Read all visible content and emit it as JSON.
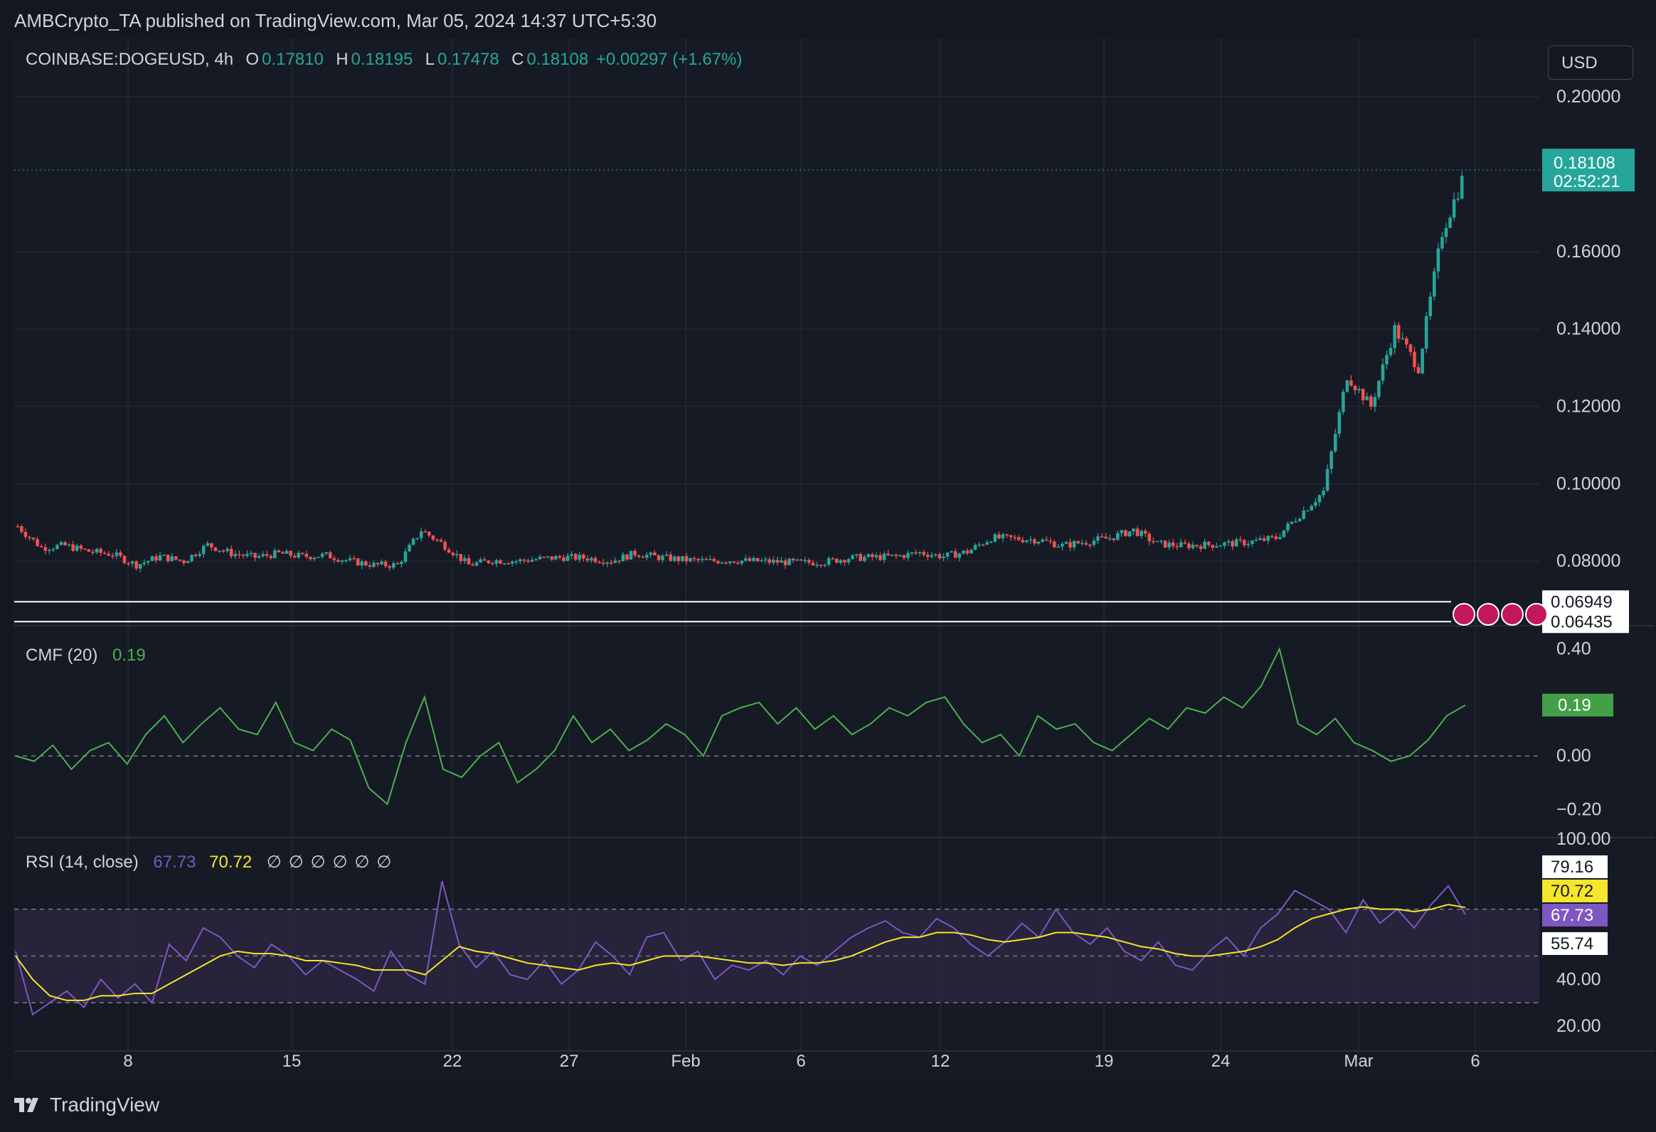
{
  "header": {
    "published_text": "AMBCrypto_TA published on TradingView.com, Mar 05, 2024 14:37 UTC+5:30"
  },
  "currency_button": "USD",
  "footer": {
    "brand": "TradingView"
  },
  "colors": {
    "background": "#131722",
    "panel": "#161a25",
    "grid": "#242833",
    "up": "#26a69a",
    "down": "#ef5350",
    "cmf_line": "#4caf50",
    "rsi_line": "#7e57c2",
    "rsi_ma": "#f5e52b",
    "rsi_band": "#2a2540"
  },
  "chart_data": [
    {
      "type": "candlestick",
      "title": "COINBASE:DOGEUSD, 4h",
      "symbol": "COINBASE:DOGEUSD",
      "interval": "4h",
      "ohlc_labels": {
        "O": "0.17810",
        "H": "0.18195",
        "L": "0.17478",
        "C": "0.18108"
      },
      "change": "+0.00297 (+1.67%)",
      "last_price": "0.18108",
      "countdown": "02:52:21",
      "price_axis_ticks": [
        "0.20000",
        "0.16000",
        "0.14000",
        "0.12000",
        "0.10000",
        "0.08000"
      ],
      "horizontal_lines": [
        {
          "value": 0.06949,
          "label": "0.06949"
        },
        {
          "value": 0.06435,
          "label": "0.06435"
        }
      ],
      "ylim": [
        0.0655,
        0.2085
      ],
      "x_axis_ticks": [
        "8",
        "15",
        "22",
        "27",
        "Feb",
        "6",
        "12",
        "19",
        "24",
        "Mar",
        "6"
      ],
      "close_series": [
        {
          "d": "Jan 4",
          "v": 0.089
        },
        {
          "d": "Jan 5",
          "v": 0.0835
        },
        {
          "d": "Jan 6",
          "v": 0.084
        },
        {
          "d": "Jan 7",
          "v": 0.0825
        },
        {
          "d": "Jan 8",
          "v": 0.0818
        },
        {
          "d": "Jan 9",
          "v": 0.079
        },
        {
          "d": "Jan 10",
          "v": 0.0812
        },
        {
          "d": "Jan 11",
          "v": 0.08
        },
        {
          "d": "Jan 12",
          "v": 0.0842
        },
        {
          "d": "Jan 13",
          "v": 0.082
        },
        {
          "d": "Jan 14",
          "v": 0.081
        },
        {
          "d": "Jan 15",
          "v": 0.082
        },
        {
          "d": "Jan 16",
          "v": 0.0812
        },
        {
          "d": "Jan 17",
          "v": 0.0815
        },
        {
          "d": "Jan 18",
          "v": 0.08
        },
        {
          "d": "Jan 19",
          "v": 0.079
        },
        {
          "d": "Jan 20",
          "v": 0.079
        },
        {
          "d": "Jan 21",
          "v": 0.088
        },
        {
          "d": "Jan 22",
          "v": 0.084
        },
        {
          "d": "Jan 23",
          "v": 0.079
        },
        {
          "d": "Jan 24",
          "v": 0.0802
        },
        {
          "d": "Jan 25",
          "v": 0.08
        },
        {
          "d": "Jan 26",
          "v": 0.0806
        },
        {
          "d": "Jan 27",
          "v": 0.081
        },
        {
          "d": "Jan 28",
          "v": 0.0808
        },
        {
          "d": "Jan 29",
          "v": 0.08
        },
        {
          "d": "Jan 30",
          "v": 0.082
        },
        {
          "d": "Jan 31",
          "v": 0.081
        },
        {
          "d": "Feb 1",
          "v": 0.0804
        },
        {
          "d": "Feb 2",
          "v": 0.08
        },
        {
          "d": "Feb 3",
          "v": 0.0802
        },
        {
          "d": "Feb 4",
          "v": 0.08
        },
        {
          "d": "Feb 5",
          "v": 0.0798
        },
        {
          "d": "Feb 6",
          "v": 0.0796
        },
        {
          "d": "Feb 7",
          "v": 0.0798
        },
        {
          "d": "Feb 8",
          "v": 0.0808
        },
        {
          "d": "Feb 9",
          "v": 0.081
        },
        {
          "d": "Feb 10",
          "v": 0.0812
        },
        {
          "d": "Feb 11",
          "v": 0.0822
        },
        {
          "d": "Feb 12",
          "v": 0.0812
        },
        {
          "d": "Feb 13",
          "v": 0.0824
        },
        {
          "d": "Feb 14",
          "v": 0.086
        },
        {
          "d": "Feb 15",
          "v": 0.0858
        },
        {
          "d": "Feb 16",
          "v": 0.0855
        },
        {
          "d": "Feb 17",
          "v": 0.084
        },
        {
          "d": "Feb 18",
          "v": 0.085
        },
        {
          "d": "Feb 19",
          "v": 0.086
        },
        {
          "d": "Feb 20",
          "v": 0.088
        },
        {
          "d": "Feb 21",
          "v": 0.0845
        },
        {
          "d": "Feb 22",
          "v": 0.084
        },
        {
          "d": "Feb 23",
          "v": 0.0842
        },
        {
          "d": "Feb 24",
          "v": 0.0845
        },
        {
          "d": "Feb 25",
          "v": 0.085
        },
        {
          "d": "Feb 26",
          "v": 0.086
        },
        {
          "d": "Feb 27",
          "v": 0.092
        },
        {
          "d": "Feb 28",
          "v": 0.098
        },
        {
          "d": "Feb 29",
          "v": 0.128
        },
        {
          "d": "Mar 1",
          "v": 0.12
        },
        {
          "d": "Mar 2",
          "v": 0.14
        },
        {
          "d": "Mar 3",
          "v": 0.13
        },
        {
          "d": "Mar 4",
          "v": 0.165
        },
        {
          "d": "Mar 5",
          "v": 0.1811
        }
      ]
    },
    {
      "type": "line",
      "title": "CMF (20)",
      "last_value": "0.19",
      "y_axis_ticks": [
        "0.40",
        "0.00",
        "−0.20"
      ],
      "ylim": [
        -0.3,
        0.46
      ],
      "series": [
        {
          "values": [
            0.0,
            -0.02,
            0.04,
            -0.05,
            0.02,
            0.05,
            -0.03,
            0.08,
            0.15,
            0.05,
            0.12,
            0.18,
            0.1,
            0.08,
            0.2,
            0.05,
            0.02,
            0.1,
            0.06,
            -0.12,
            -0.18,
            0.05,
            0.22,
            -0.05,
            -0.08,
            0.0,
            0.05,
            -0.1,
            -0.05,
            0.02,
            0.15,
            0.05,
            0.1,
            0.02,
            0.06,
            0.12,
            0.08,
            0.0,
            0.15,
            0.18,
            0.2,
            0.12,
            0.18,
            0.1,
            0.15,
            0.08,
            0.12,
            0.18,
            0.15,
            0.2,
            0.22,
            0.12,
            0.05,
            0.08,
            0.0,
            0.15,
            0.1,
            0.12,
            0.05,
            0.02,
            0.08,
            0.14,
            0.1,
            0.18,
            0.16,
            0.22,
            0.18,
            0.26,
            0.4,
            0.12,
            0.08,
            0.14,
            0.05,
            0.02,
            -0.02,
            0.0,
            0.06,
            0.15,
            0.19
          ]
        }
      ]
    },
    {
      "type": "line",
      "title": "RSI (14, close)",
      "rsi_value": "67.73",
      "rsi_ma_value": "70.72",
      "na_placeholders": [
        "∅",
        "∅",
        "∅",
        "∅",
        "∅",
        "∅"
      ],
      "y_axis_ticks": [
        "100.00",
        "40.00",
        "20.00"
      ],
      "price_labels": [
        "79.16",
        "70.72",
        "67.73",
        "55.74"
      ],
      "bands": {
        "upper": 70,
        "middle": 50,
        "lower": 30
      },
      "ylim": [
        10,
        100
      ],
      "series": [
        {
          "values": [
            52,
            25,
            30,
            35,
            28,
            40,
            32,
            38,
            30,
            55,
            48,
            62,
            58,
            50,
            45,
            55,
            50,
            42,
            48,
            44,
            40,
            35,
            52,
            42,
            38,
            82,
            55,
            45,
            52,
            42,
            40,
            48,
            38,
            44,
            56,
            50,
            42,
            58,
            60,
            48,
            52,
            40,
            46,
            44,
            48,
            42,
            50,
            46,
            52,
            58,
            62,
            65,
            60,
            58,
            66,
            62,
            55,
            50,
            56,
            64,
            58,
            70,
            60,
            55,
            62,
            52,
            48,
            56,
            46,
            44,
            52,
            58,
            50,
            62,
            68,
            78,
            74,
            70,
            60,
            74,
            64,
            70,
            62,
            72,
            80,
            67.73
          ]
        },
        {
          "values": [
            50,
            40,
            33,
            31,
            31,
            33,
            33,
            34,
            34,
            38,
            42,
            46,
            50,
            52,
            51,
            51,
            50,
            48,
            48,
            47,
            46,
            44,
            44,
            44,
            42,
            48,
            54,
            52,
            51,
            49,
            47,
            46,
            45,
            44,
            46,
            47,
            46,
            48,
            50,
            50,
            50,
            49,
            48,
            47,
            47,
            46,
            47,
            47,
            48,
            50,
            53,
            56,
            58,
            58,
            60,
            60,
            59,
            57,
            56,
            57,
            58,
            60,
            60,
            59,
            58,
            56,
            54,
            53,
            51,
            50,
            50,
            51,
            52,
            54,
            57,
            62,
            66,
            68,
            70,
            71,
            70,
            70,
            69,
            70,
            72,
            70.72
          ]
        }
      ]
    }
  ]
}
